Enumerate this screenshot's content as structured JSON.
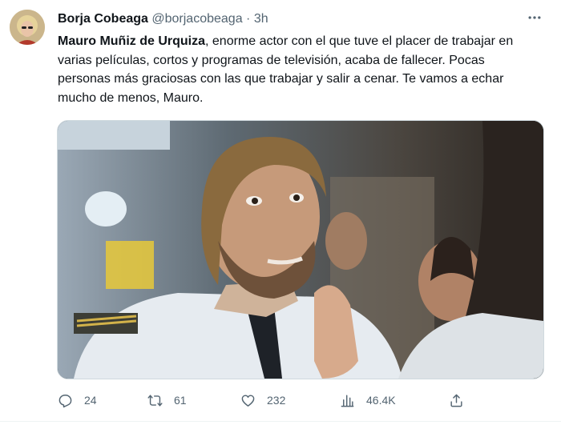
{
  "tweet": {
    "author": {
      "name": "Borja Cobeaga",
      "handle": "@borjacobeaga",
      "separator": "·",
      "time": "3h"
    },
    "text": {
      "mention": "Mauro Muñiz de Urquiza",
      "body": ", enorme actor con el que tuve el placer de trabajar en varias películas, cortos y programas de televisión, acaba de fallecer. Pocas personas más graciosas con las que trabajar y salir a cenar. Te vamos a echar mucho de menos, Mauro."
    },
    "actions": {
      "replies": "24",
      "retweets": "61",
      "likes": "232",
      "views": "46.4K"
    },
    "icons": [
      "more-icon",
      "reply-icon",
      "retweet-icon",
      "like-icon",
      "views-icon",
      "share-icon"
    ]
  },
  "colors": {
    "text": "#0f1419",
    "secondary": "#536471",
    "border": "#cfd9de"
  }
}
